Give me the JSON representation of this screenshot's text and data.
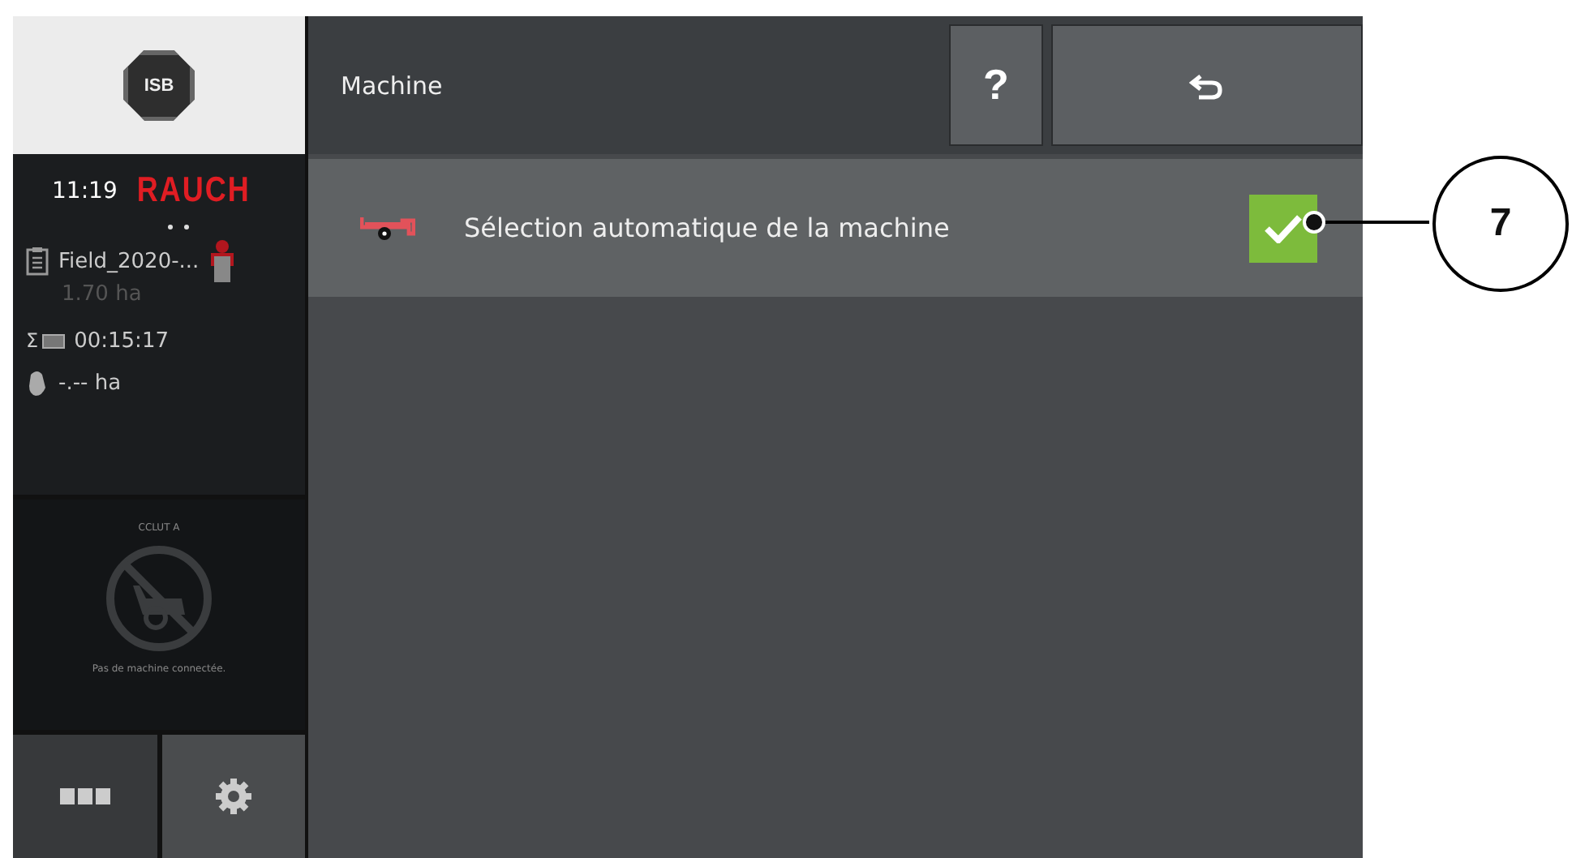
{
  "isb_label": "ISB",
  "sidebar": {
    "time": "11:19",
    "brand": "RAUCH",
    "field": "Field_2020-...",
    "area": "1.70 ha",
    "sum_symbol": "Σ",
    "duration": "00:15:17",
    "worked_area": "-.-- ha",
    "machine_panel": {
      "title": "CCLUT A",
      "message": "Pas de machine connectée."
    }
  },
  "header": {
    "title": "Machine",
    "help_label": "?"
  },
  "settings": [
    {
      "label": "Sélection automatique de la machine",
      "checked": true
    }
  ],
  "callout": {
    "number": "7"
  }
}
